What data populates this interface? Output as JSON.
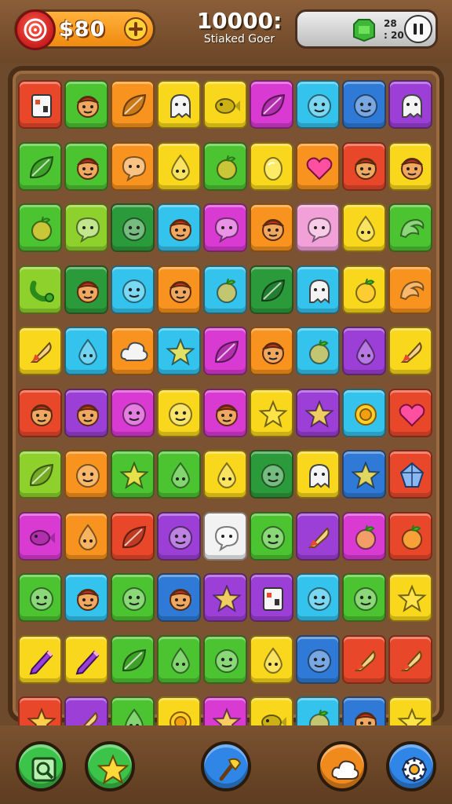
{
  "hud": {
    "coins": "$80",
    "score": "10000:",
    "score_label": "Stiaked Goer",
    "status_top": "28",
    "status_bottom": ": 20"
  },
  "colors": {
    "red": "#e8472a",
    "green": "#4cc431",
    "orange": "#f7931e",
    "yellow": "#f8d71c",
    "cyan": "#34c3ec",
    "blue": "#2e7ad6",
    "purple": "#9b3fd6",
    "magenta": "#d83ad2",
    "lime": "#8fd12c",
    "darkgreen": "#2b9a3a",
    "pink": "#f2a0d8",
    "white": "#f2f2f2"
  },
  "board": {
    "rows": [
      [
        [
          "red",
          "card"
        ],
        [
          "green",
          "face"
        ],
        [
          "orange",
          "leaf"
        ],
        [
          "yellow",
          "ghost"
        ],
        [
          "yellow",
          "fish"
        ],
        [
          "magenta",
          "leaf"
        ],
        [
          "cyan",
          "blob"
        ],
        [
          "blue",
          "blob"
        ],
        [
          "purple",
          "ghost"
        ]
      ],
      [
        [
          "green",
          "leaf"
        ],
        [
          "green",
          "face"
        ],
        [
          "orange",
          "bubble"
        ],
        [
          "yellow",
          "drop"
        ],
        [
          "green",
          "fruit"
        ],
        [
          "yellow",
          "egg"
        ],
        [
          "orange",
          "heart"
        ],
        [
          "red",
          "face"
        ],
        [
          "yellow",
          "face"
        ]
      ],
      [
        [
          "green",
          "fruit"
        ],
        [
          "lime",
          "bubble"
        ],
        [
          "darkgreen",
          "blob"
        ],
        [
          "cyan",
          "face"
        ],
        [
          "magenta",
          "bubble"
        ],
        [
          "orange",
          "face"
        ],
        [
          "pink",
          "bubble"
        ],
        [
          "yellow",
          "drop"
        ],
        [
          "green",
          "wave"
        ]
      ],
      [
        [
          "lime",
          "snake"
        ],
        [
          "darkgreen",
          "face"
        ],
        [
          "cyan",
          "blob"
        ],
        [
          "orange",
          "face"
        ],
        [
          "cyan",
          "fruit"
        ],
        [
          "darkgreen",
          "leaf"
        ],
        [
          "cyan",
          "ghost"
        ],
        [
          "yellow",
          "fruit"
        ],
        [
          "orange",
          "wave"
        ]
      ],
      [
        [
          "yellow",
          "rocket"
        ],
        [
          "cyan",
          "drop"
        ],
        [
          "orange",
          "cloud"
        ],
        [
          "cyan",
          "star"
        ],
        [
          "magenta",
          "leaf"
        ],
        [
          "orange",
          "face"
        ],
        [
          "cyan",
          "fruit"
        ],
        [
          "purple",
          "drop"
        ],
        [
          "yellow",
          "rocket"
        ]
      ],
      [
        [
          "red",
          "face"
        ],
        [
          "purple",
          "face"
        ],
        [
          "magenta",
          "blob"
        ],
        [
          "yellow",
          "blob"
        ],
        [
          "magenta",
          "face"
        ],
        [
          "yellow",
          "star"
        ],
        [
          "purple",
          "star"
        ],
        [
          "cyan",
          "ring"
        ],
        [
          "red",
          "heart"
        ]
      ],
      [
        [
          "lime",
          "leaf"
        ],
        [
          "orange",
          "blob"
        ],
        [
          "green",
          "star"
        ],
        [
          "green",
          "drop"
        ],
        [
          "yellow",
          "drop"
        ],
        [
          "darkgreen",
          "blob"
        ],
        [
          "yellow",
          "ghost"
        ],
        [
          "blue",
          "star"
        ],
        [
          "red",
          "crystal"
        ]
      ],
      [
        [
          "magenta",
          "fish"
        ],
        [
          "orange",
          "drop"
        ],
        [
          "red",
          "leaf"
        ],
        [
          "purple",
          "blob"
        ],
        [
          "white",
          "bubble"
        ],
        [
          "green",
          "blob"
        ],
        [
          "purple",
          "rocket"
        ],
        [
          "magenta",
          "fruit"
        ],
        [
          "red",
          "fruit"
        ]
      ],
      [
        [
          "green",
          "blob"
        ],
        [
          "cyan",
          "face"
        ],
        [
          "green",
          "blob"
        ],
        [
          "blue",
          "face"
        ],
        [
          "purple",
          "star"
        ],
        [
          "purple",
          "card"
        ],
        [
          "cyan",
          "blob"
        ],
        [
          "green",
          "blob"
        ],
        [
          "yellow",
          "star"
        ]
      ],
      [
        [
          "yellow",
          "pencil"
        ],
        [
          "yellow",
          "pencil"
        ],
        [
          "green",
          "leaf"
        ],
        [
          "green",
          "drop"
        ],
        [
          "green",
          "blob"
        ],
        [
          "yellow",
          "drop"
        ],
        [
          "blue",
          "blob"
        ],
        [
          "red",
          "rocket"
        ],
        [
          "red",
          "rocket"
        ]
      ],
      [
        [
          "red",
          "star"
        ],
        [
          "purple",
          "rocket"
        ],
        [
          "green",
          "drop"
        ],
        [
          "yellow",
          "ring"
        ],
        [
          "magenta",
          "star"
        ],
        [
          "yellow",
          "fish"
        ],
        [
          "cyan",
          "fruit"
        ],
        [
          "blue",
          "face"
        ],
        [
          "yellow",
          "star"
        ]
      ]
    ]
  },
  "tools": [
    {
      "name": "shuffle-icon",
      "color": "#3cc44a"
    },
    {
      "name": "star-icon",
      "color": "#3cc44a"
    },
    {
      "name": "hammer-icon",
      "color": "#2f86e6"
    },
    {
      "name": "cloud-icon",
      "color": "#f08a1c"
    },
    {
      "name": "gear-icon",
      "color": "#2f86e6"
    }
  ]
}
